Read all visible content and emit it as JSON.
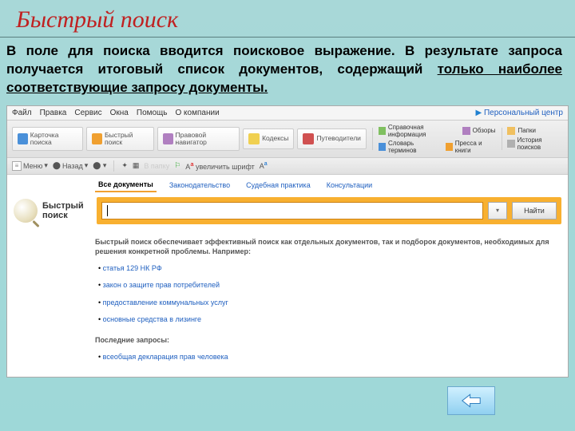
{
  "slide": {
    "title": "Быстрый поиск",
    "desc_plain": "В поле для поиска вводится поисковое выражение. В результате запроса получается итоговый список документов, содержащий ",
    "desc_under": "только наиболее соответствующие запросу документы."
  },
  "menubar": {
    "items": [
      "Файл",
      "Правка",
      "Сервис",
      "Окна",
      "Помощь",
      "О компании"
    ],
    "right_link": "Персональный центр"
  },
  "toolbar1": {
    "btns": [
      {
        "label": "Карточка\nпоиска",
        "icon": "ico-blue"
      },
      {
        "label": "Быстрый\nпоиск",
        "icon": "ico-orange"
      },
      {
        "label": "Правовой\nнавигатор",
        "icon": "ico-purple"
      },
      {
        "label": "Кодексы",
        "icon": "ico-yellow"
      },
      {
        "label": "Путеводители",
        "icon": "ico-red"
      }
    ],
    "btns2": [
      {
        "label": "Справочная информация",
        "icon": "ico-green"
      },
      {
        "label": "Обзоры",
        "icon": "ico-purple"
      },
      {
        "label": "Словарь терминов",
        "icon": "ico-blue"
      },
      {
        "label": "Пресса и книги",
        "icon": "ico-orange"
      }
    ],
    "btns3": [
      {
        "label": "Папки",
        "icon": "ico-folder"
      },
      {
        "label": "История поисков",
        "icon": "ico-gray"
      }
    ]
  },
  "toolbar2": {
    "menu": "Меню",
    "back": "Назад",
    "enlarge": "увеличить шрифт"
  },
  "tabs": {
    "items": [
      "Все документы",
      "Законодательство",
      "Судебная практика",
      "Консультации"
    ],
    "active": 0
  },
  "search": {
    "label_line1": "Быстрый",
    "label_line2": "поиск",
    "value": "",
    "find": "Найти"
  },
  "body": {
    "intro": "Быстрый поиск обеспечивает эффективный поиск как отдельных документов, так и подборок документов, необходимых для решения конкретной проблемы. Например:",
    "examples": [
      "статья 129 НК РФ",
      "закон о защите прав потребителей",
      "предоставление коммунальных услуг",
      "основные средства в лизинге"
    ],
    "recent_title": "Последние запросы:",
    "recent": [
      "всеобщая декларация прав человека"
    ]
  },
  "nav": {
    "prev": "prev"
  }
}
